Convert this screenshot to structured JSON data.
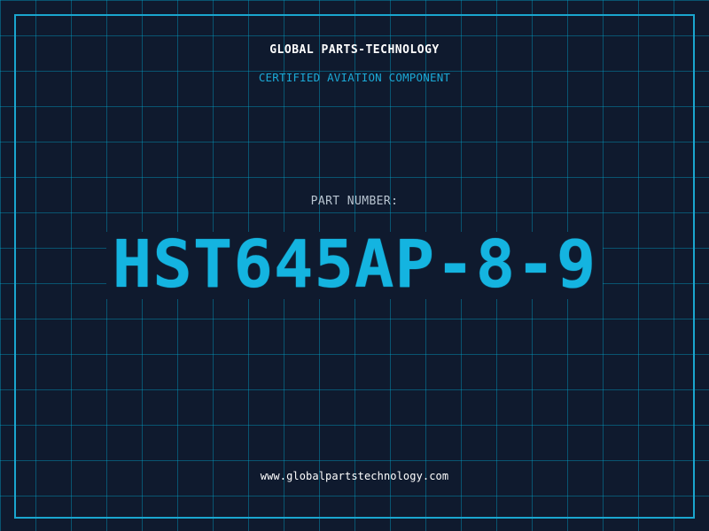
{
  "card": {
    "brand": "GLOBAL PARTS-TECHNOLOGY",
    "tagline": "CERTIFIED AVIATION COMPONENT",
    "part_label": "PART NUMBER:",
    "part_number": "HST645AP-8-9",
    "website": "www.globalpartstechnology.com"
  },
  "colors": {
    "background": "#0f1a2e",
    "grid": "#0aa9d2",
    "accent": "#14b4e0",
    "text_primary": "#ffffff",
    "text_muted": "#b8c4d0"
  }
}
